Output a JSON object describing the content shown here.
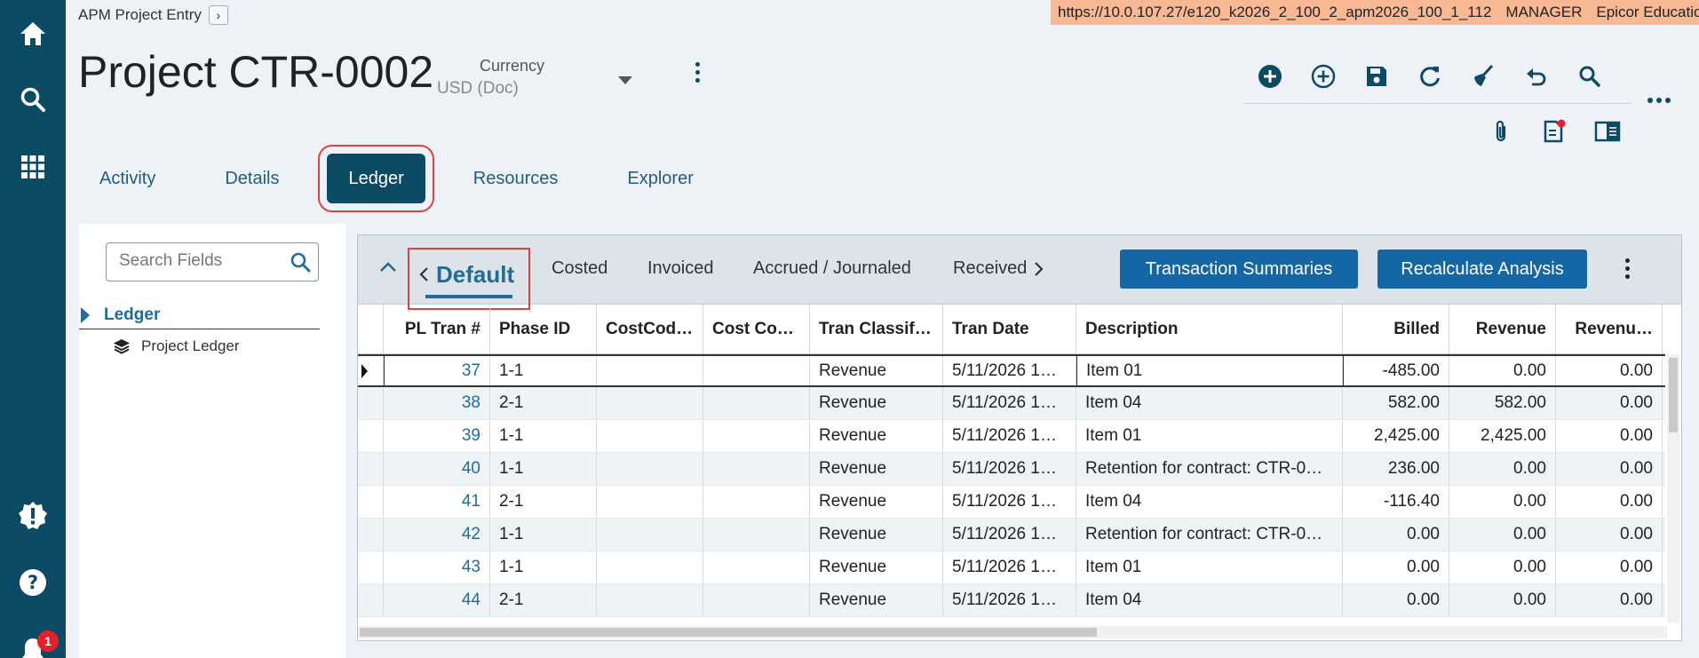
{
  "app": {
    "breadcrumb": "APM Project Entry",
    "env_url": "https://10.0.107.27/e120_k2026_2_100_2_apm2026_100_1_112",
    "env_user": "MANAGER",
    "env_company": "Epicor Education"
  },
  "rail": {
    "icons": [
      "home-icon",
      "search-icon",
      "apps-grid-icon",
      "alert-icon",
      "help-icon",
      "notifications-bell-icon"
    ],
    "notification_count": "1"
  },
  "header": {
    "title": "Project CTR-0002",
    "currency_label": "Currency",
    "currency_value": "USD (Doc)"
  },
  "toolbar": {
    "icons": [
      "add-circle-icon",
      "add-outline-icon",
      "save-icon",
      "refresh-icon",
      "clear-icon",
      "undo-icon",
      "search-icon"
    ],
    "secondary_icons": [
      "attachment-icon",
      "notes-icon",
      "panel-icon"
    ]
  },
  "tabs": [
    "Activity",
    "Details",
    "Ledger",
    "Resources",
    "Explorer"
  ],
  "active_tab": "Ledger",
  "left_panel": {
    "search_placeholder": "Search Fields",
    "section": "Ledger",
    "item": "Project Ledger"
  },
  "grid": {
    "subtabs": {
      "default": "Default",
      "others": [
        "Costed",
        "Invoiced",
        "Accrued / Journaled",
        "Received"
      ]
    },
    "buttons": {
      "transaction_summaries": "Transaction Summaries",
      "recalculate_analysis": "Recalculate Analysis"
    },
    "columns": [
      "PL Tran #",
      "Phase ID",
      "CostCod…",
      "Cost Co…",
      "Tran Classif…",
      "Tran Date",
      "Description",
      "Billed",
      "Revenue",
      "Revenu…"
    ],
    "rows": [
      [
        "37",
        "1-1",
        "",
        "",
        "Revenue",
        "5/11/2026 1…",
        "Item 01",
        "-485.00",
        "0.00",
        "0.00"
      ],
      [
        "38",
        "2-1",
        "",
        "",
        "Revenue",
        "5/11/2026 1…",
        "Item 04",
        "582.00",
        "582.00",
        "0.00"
      ],
      [
        "39",
        "1-1",
        "",
        "",
        "Revenue",
        "5/11/2026 1…",
        "Item 01",
        "2,425.00",
        "2,425.00",
        "0.00"
      ],
      [
        "40",
        "1-1",
        "",
        "",
        "Revenue",
        "5/11/2026 1…",
        "Retention for contract: CTR-0…",
        "236.00",
        "0.00",
        "0.00"
      ],
      [
        "41",
        "2-1",
        "",
        "",
        "Revenue",
        "5/11/2026 1…",
        "Item 04",
        "-116.40",
        "0.00",
        "0.00"
      ],
      [
        "42",
        "1-1",
        "",
        "",
        "Revenue",
        "5/11/2026 1…",
        "Retention for contract: CTR-0…",
        "0.00",
        "0.00",
        "0.00"
      ],
      [
        "43",
        "1-1",
        "",
        "",
        "Revenue",
        "5/11/2026 1…",
        "Item 01",
        "0.00",
        "0.00",
        "0.00"
      ],
      [
        "44",
        "2-1",
        "",
        "",
        "Revenue",
        "5/11/2026 1…",
        "Item 04",
        "0.00",
        "0.00",
        "0.00"
      ]
    ]
  },
  "colors": {
    "rail": "#0d4a63",
    "accent": "#1f6e99",
    "button": "#1566a4",
    "env_banner": "#f8b894",
    "highlight": "#e04040"
  }
}
